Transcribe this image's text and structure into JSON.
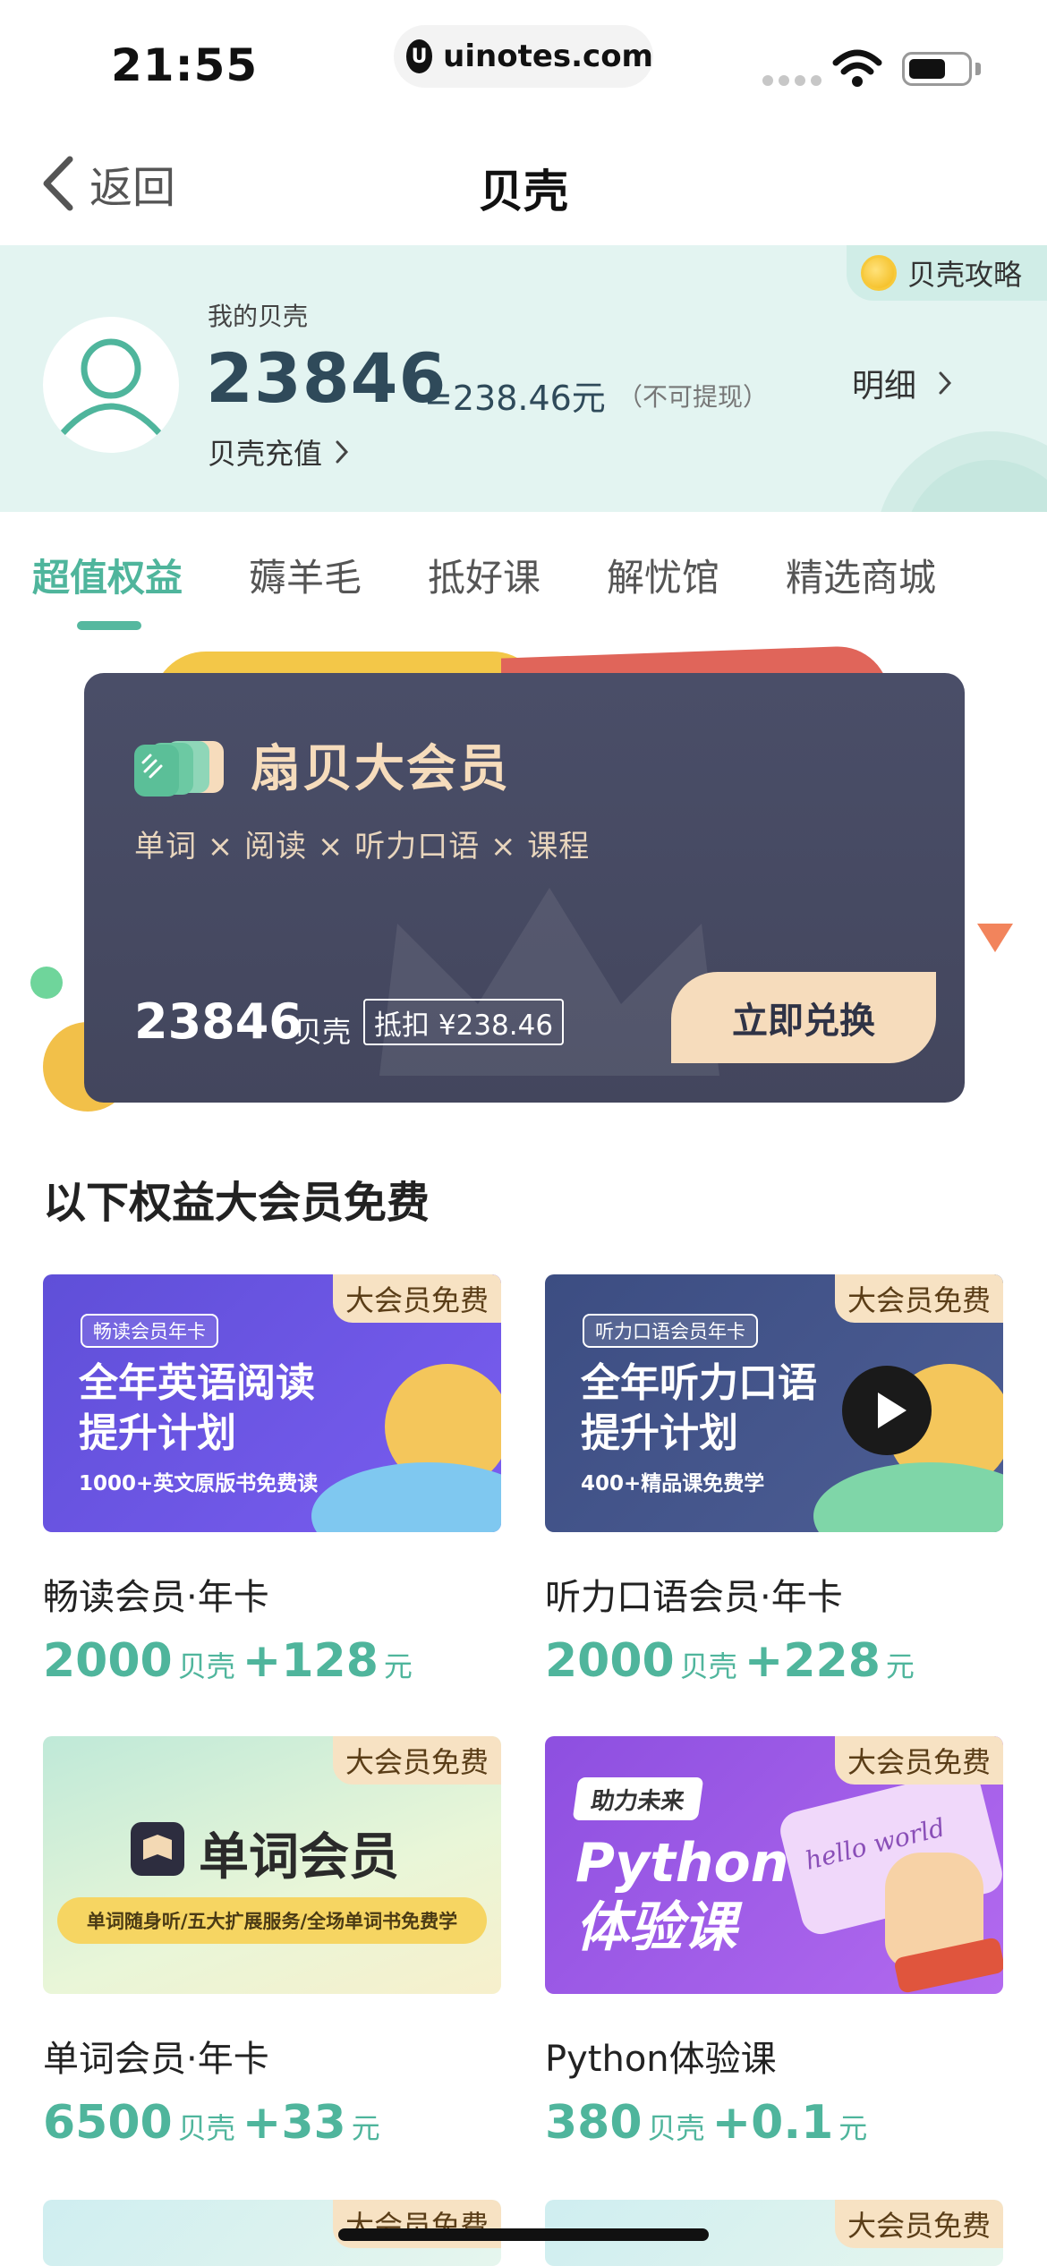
{
  "status_bar": {
    "time": "21:55",
    "url": "uinotes.com"
  },
  "nav": {
    "back_label": "返回",
    "title": "贝壳"
  },
  "wallet": {
    "guide_label": "贝壳攻略",
    "my_label": "我的贝壳",
    "balance": "23846",
    "equivalent": "=238.46元",
    "note": "（不可提现）",
    "recharge_label": "贝壳充值",
    "detail_label": "明细"
  },
  "tabs": [
    "超值权益",
    "薅羊毛",
    "抵好课",
    "解忧馆",
    "精选商城"
  ],
  "vip": {
    "title": "扇贝大会员",
    "subtitle": "单词 × 阅读 × 听力口语 × 课程",
    "points": "23846",
    "points_unit": "贝壳",
    "deduct": "抵扣 ¥238.46",
    "button": "立即兑换"
  },
  "section_title": "以下权益大会员免费",
  "badge_label": "大会员免费",
  "products": [
    {
      "name": "畅读会员·年卡",
      "shells": "2000",
      "shell_unit": "贝壳",
      "plus": "+",
      "yuan": "128",
      "yuan_unit": "元",
      "thumb": {
        "chip": "畅读会员年卡",
        "title_line1": "全年英语阅读",
        "title_line2": "提升计划",
        "sub": "1000+英文原版书免费读"
      }
    },
    {
      "name": "听力口语会员·年卡",
      "shells": "2000",
      "shell_unit": "贝壳",
      "plus": "+",
      "yuan": "228",
      "yuan_unit": "元",
      "thumb": {
        "chip": "听力口语会员年卡",
        "title_line1": "全年听力口语",
        "title_line2": "提升计划",
        "sub": "400+精品课免费学"
      }
    },
    {
      "name": "单词会员·年卡",
      "shells": "6500",
      "shell_unit": "贝壳",
      "plus": "+",
      "yuan": "33",
      "yuan_unit": "元",
      "thumb": {
        "title": "单词会员",
        "bar": "单词随身听/五大扩展服务/全场单词书免费学"
      }
    },
    {
      "name": "Python体验课",
      "shells": "380",
      "shell_unit": "贝壳",
      "plus": "+",
      "yuan": "0.1",
      "yuan_unit": "元",
      "thumb": {
        "chip": "助力未来",
        "title_line1": "Python",
        "title_line2": "体验课",
        "screen_text": "hello world"
      }
    }
  ],
  "colors": {
    "accent": "#4fb59c",
    "card": "#474a62",
    "gold": "#f6dcbc",
    "header_bg": "#e3f4f1"
  }
}
